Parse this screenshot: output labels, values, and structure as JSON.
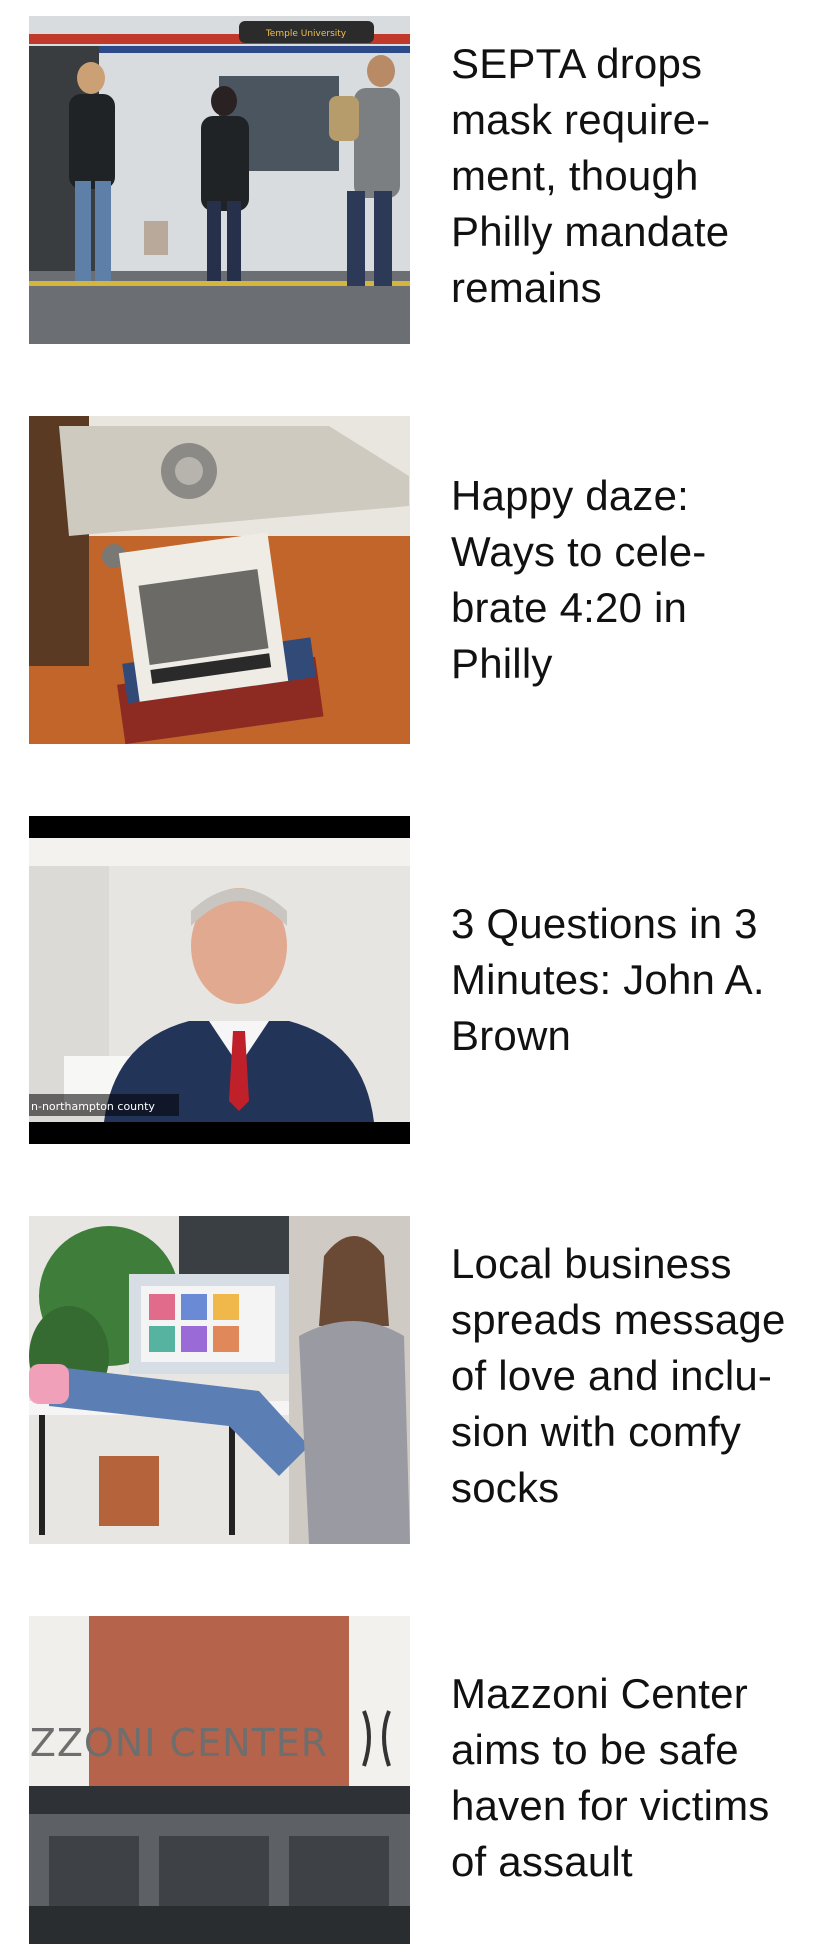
{
  "articles": [
    {
      "headline_lines": [
        "SEPTA drops",
        "mask require-",
        "ment, though",
        "Philly mandate",
        "remains"
      ],
      "image_desc": "commuters-on-train-platform",
      "image_text": "Temple University"
    },
    {
      "headline_lines": [
        "Happy daze:",
        "Ways to cele-",
        "brate 4:20 in",
        "Philly"
      ],
      "image_desc": "cassette-tapes-and-record-player"
    },
    {
      "headline_lines": [
        "3 Questions in 3",
        "Minutes: John A.",
        "Brown"
      ],
      "image_desc": "video-call-portrait",
      "image_caption": "n-northampton county"
    },
    {
      "headline_lines": [
        "Local business",
        "spreads message",
        "of love and inclu-",
        "sion with comfy",
        "socks"
      ],
      "image_desc": "woman-with-feet-on-desk"
    },
    {
      "headline_lines": [
        "Mazzoni Center",
        "aims to be safe",
        "haven for victims",
        "of assault"
      ],
      "image_desc": "building-facade-with-sign",
      "image_text": "ZZONI CENTER"
    }
  ]
}
